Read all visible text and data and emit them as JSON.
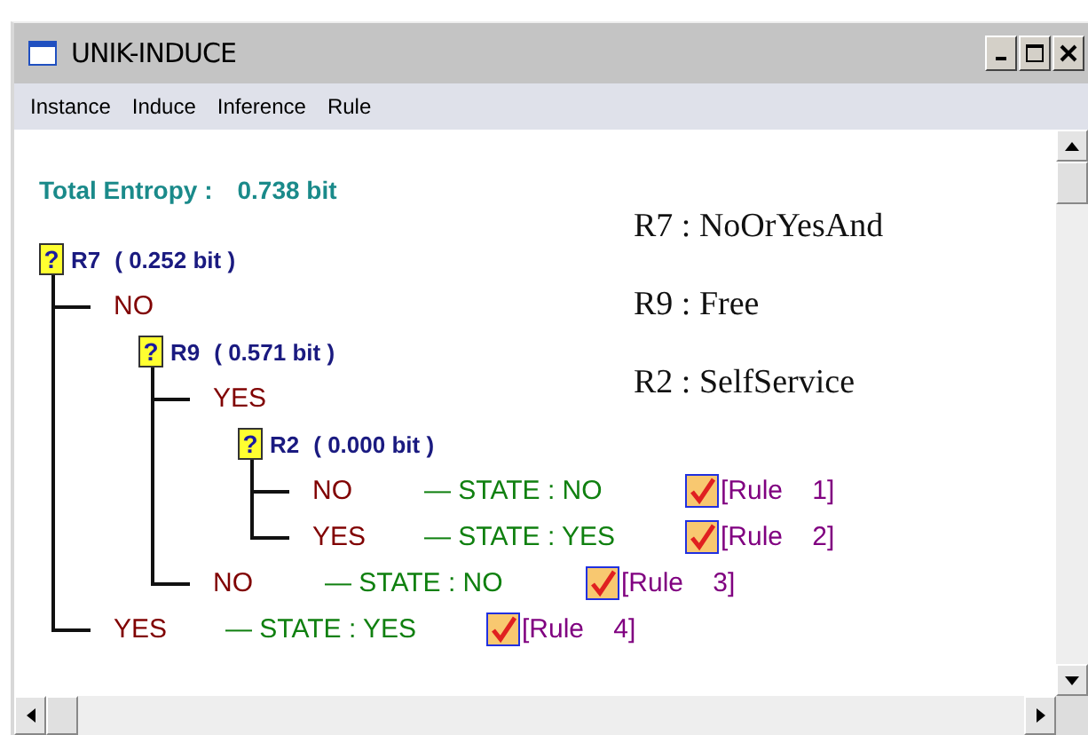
{
  "window": {
    "title": "UNIK-INDUCE"
  },
  "menu": [
    {
      "label": "Instance"
    },
    {
      "label": "Induce"
    },
    {
      "label": "Inference"
    },
    {
      "label": "Rule"
    }
  ],
  "total_entropy": {
    "label": "Total Entropy :",
    "value": "0.738 bit"
  },
  "tree": {
    "kind": "node",
    "icon": "?",
    "name": "R7",
    "entropy": "( 0.252 bit )",
    "children": [
      {
        "kind": "branch",
        "value": "NO",
        "children": [
          {
            "kind": "node",
            "icon": "?",
            "name": "R9",
            "entropy": "( 0.571 bit )",
            "children": [
              {
                "kind": "branch",
                "value": "YES",
                "children": [
                  {
                    "kind": "node",
                    "icon": "?",
                    "name": "R2",
                    "entropy": "( 0.000 bit )",
                    "children": [
                      {
                        "kind": "leaf",
                        "value": "NO",
                        "state": "— STATE : NO",
                        "checked": true,
                        "rule": "[Rule    1]"
                      },
                      {
                        "kind": "leaf",
                        "value": "YES",
                        "state": "— STATE : YES",
                        "checked": true,
                        "rule": "[Rule    2]"
                      }
                    ]
                  }
                ]
              },
              {
                "kind": "leaf",
                "value": "NO",
                "state": "— STATE : NO",
                "checked": true,
                "rule": "[Rule    3]"
              }
            ]
          }
        ]
      },
      {
        "kind": "leaf",
        "value": "YES",
        "state": "— STATE : YES",
        "checked": true,
        "rule": "[Rule    4]"
      }
    ]
  },
  "legend": [
    "R7 : NoOrYesAnd",
    "R9 : Free",
    "R2 : SelfService"
  ]
}
